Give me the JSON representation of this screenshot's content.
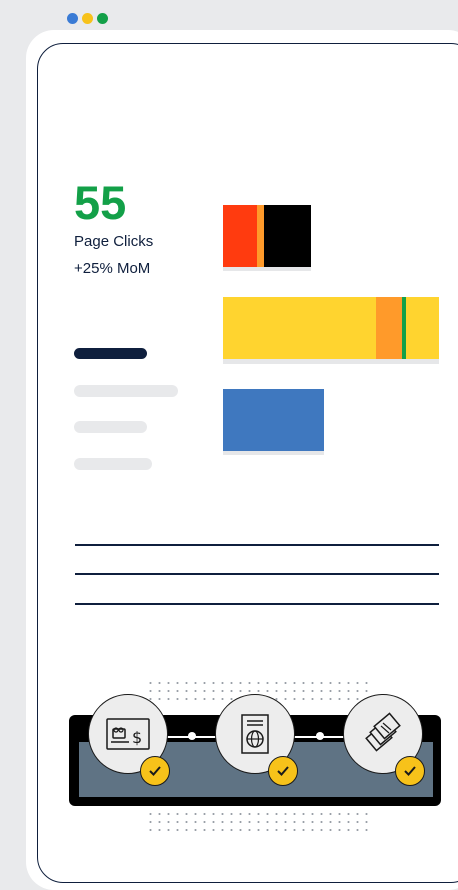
{
  "window": {
    "controls": [
      {
        "name": "window-dot-blue",
        "color": "#3a7bd5"
      },
      {
        "name": "window-dot-yellow",
        "color": "#f7c21a"
      },
      {
        "name": "window-dot-green",
        "color": "#13a048"
      }
    ]
  },
  "metric": {
    "value": "55",
    "label": "Page Clicks",
    "change": "+25% MoM"
  },
  "colors": {
    "accent_green": "#13a048",
    "navy": "#0f1f3d",
    "red": "#ff3b0f",
    "orange": "#ff9a2a",
    "black": "#000000",
    "yellow": "#ffd42f",
    "blue": "#3f78bf",
    "slate": "#5f7384",
    "skeleton": "#e8e9eb"
  },
  "bars": [
    {
      "name": "bar-red-black",
      "segments": [
        "#ff3b0f",
        "#ff9a2a",
        "#000000"
      ]
    },
    {
      "name": "bar-yellow",
      "segments": [
        "#ffd42f",
        "#ff9a2a",
        "#13a048",
        "#ffd42f"
      ]
    },
    {
      "name": "bar-blue",
      "segments": [
        "#3f78bf"
      ]
    }
  ],
  "steps": [
    {
      "name": "step-payment",
      "icon": "payment-card-icon",
      "status": "completed"
    },
    {
      "name": "step-passport",
      "icon": "passport-icon",
      "status": "completed"
    },
    {
      "name": "step-documents",
      "icon": "documents-stack-icon",
      "status": "completed"
    }
  ]
}
